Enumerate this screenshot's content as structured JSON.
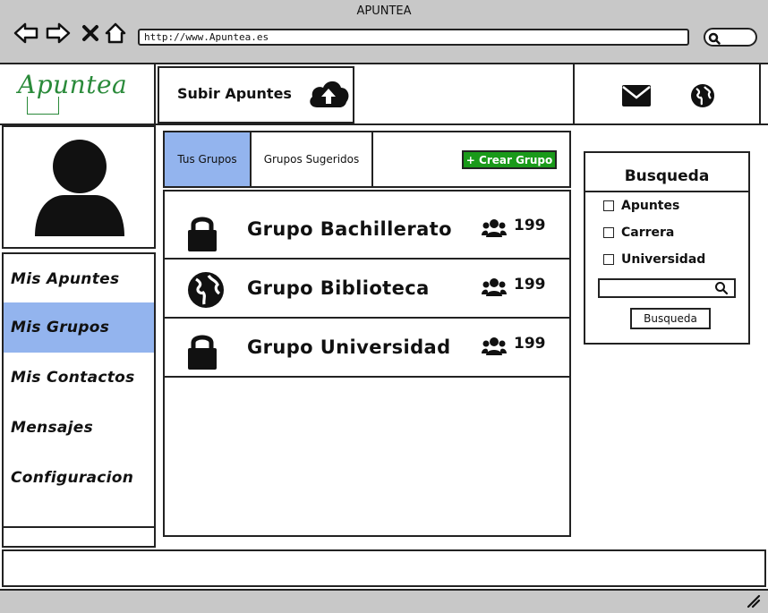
{
  "window": {
    "title": "APUNTEA"
  },
  "browser": {
    "url": "http://www.Apuntea.es",
    "nav_icons": [
      "back-icon",
      "forward-icon",
      "close-icon",
      "home-icon"
    ],
    "search_icon": "search-icon"
  },
  "header": {
    "logo_text": "Apuntea",
    "upload_label": "Subir Apuntes",
    "upload_icon": "cloud-upload-icon",
    "right_icons": [
      "mail-icon",
      "globe-icon"
    ]
  },
  "sidebar": {
    "avatar_icon": "user-avatar-icon",
    "items": [
      {
        "label": "Mis Apuntes",
        "active": false
      },
      {
        "label": "Mis Grupos",
        "active": true
      },
      {
        "label": "Mis Contactos",
        "active": false
      },
      {
        "label": "Mensajes",
        "active": false
      },
      {
        "label": "Configuracion",
        "active": false
      }
    ]
  },
  "tabs": [
    {
      "label": "Tus Grupos",
      "active": true
    },
    {
      "label": "Grupos Sugeridos",
      "active": false
    }
  ],
  "create_button": {
    "label": "+ Crear Grupo"
  },
  "groups": [
    {
      "name": "Grupo Bachillerato",
      "icon": "lock-icon",
      "members": "199"
    },
    {
      "name": "Grupo Biblioteca",
      "icon": "globe-icon",
      "members": "199"
    },
    {
      "name": "Grupo Universidad",
      "icon": "lock-icon",
      "members": "199"
    }
  ],
  "search_panel": {
    "title": "Busqueda",
    "filters": [
      "Apuntes",
      "Carrera",
      "Universidad"
    ],
    "input_value": "",
    "button_label": "Busqueda"
  },
  "colors": {
    "accent_active": "#93b4ee",
    "create_button": "#1a9a1a",
    "logo": "#2a8a3a",
    "chrome": "#c8c8c8"
  }
}
